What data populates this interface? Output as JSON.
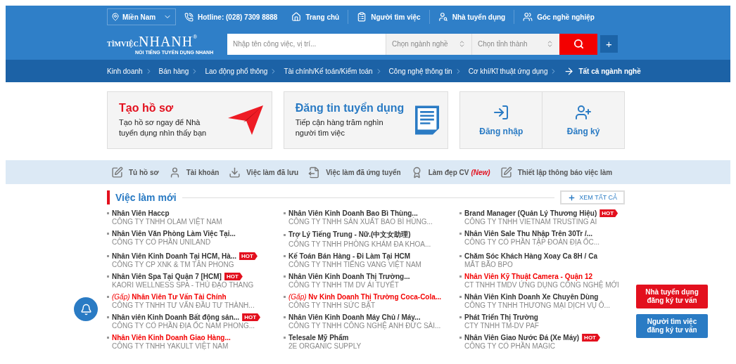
{
  "top_bar": {
    "location": "Miền Nam",
    "hotline": "Hotline: (028) 7309 8888",
    "nav": [
      {
        "label": "Trang chủ"
      },
      {
        "label": "Người tìm việc"
      },
      {
        "label": "Nhà tuyển dụng"
      },
      {
        "label": "Góc nghề nghiệp"
      }
    ]
  },
  "logo": {
    "part_1": "TÌMVIỆC",
    "part_2": "NHANH",
    "registered": "®",
    "tagline": "NỔI TIẾNG TUYỂN DỤNG NHANH"
  },
  "search": {
    "placeholder": "Nhập tên công việc, vị trí...",
    "industry": "Chọn ngành nghề",
    "province": "Chọn tỉnh thành",
    "more": "+"
  },
  "categories": [
    {
      "label": "Kinh doanh"
    },
    {
      "label": "Bán hàng"
    },
    {
      "label": "Lao động phổ thông"
    },
    {
      "label": "Tài chính/Kế toán/Kiểm toán"
    },
    {
      "label": "Công nghệ thông tin"
    },
    {
      "label": "Cơ khí/Kĩ thuật ứng dụng"
    }
  ],
  "all_categories": "Tất cả ngành nghề",
  "cards": {
    "profile": {
      "title": "Tạo hồ sơ",
      "text": "Tạo hồ sơ ngay để Nhà tuyển dụng nhìn thấy bạn"
    },
    "post": {
      "title": "Đăng tin tuyển dụng",
      "text": "Tiếp cận hàng trăm nghìn người tìm việc"
    },
    "login": "Đăng nhập",
    "register": "Đăng ký"
  },
  "quick_links": [
    {
      "label": "Tủ hồ sơ"
    },
    {
      "label": "Tài khoản"
    },
    {
      "label": "Việc làm đã lưu"
    },
    {
      "label": "Việc làm đã ứng tuyển"
    },
    {
      "label": "Làm đẹp CV",
      "badge": "(New)"
    },
    {
      "label": "Thiết lập thông báo việc làm"
    }
  ],
  "section": {
    "title": "Việc làm mới",
    "view_all": "XEM TẤT CẢ"
  },
  "jobs": [
    {
      "title": "Nhân Viên Haccp",
      "company": "CÔNG TY TNHH OLAM VIỆT NAM",
      "highlighted": false
    },
    {
      "title": "Nhân Viên Kinh Doanh Bao Bì Thùng...",
      "company": "CÔNG TY TNHH SẢN XUẤT BAO BÌ HÙNG...",
      "highlighted": false
    },
    {
      "title": "Brand Manager (Quản Lý Thương Hiệu)",
      "company": "CÔNG TY TNHH VIETNAM TRUSTING AI",
      "highlighted": false,
      "badge": "HOT"
    },
    {
      "title": "Nhân Viên Văn Phòng Làm Việc Tại...",
      "company": "CÔNG TY CỔ PHẦN UNILAND",
      "highlighted": false
    },
    {
      "title": "Trợ Lý Tiếng Trung - Nữ.(中文女助理)",
      "company": "CÔNG TY TNHH PHÒNG KHÁM ĐA KHOA...",
      "highlighted": false
    },
    {
      "title": "Nhân Viên Sale Thu Nhập Trên 30Tr /...",
      "company": "CÔNG TY CỔ PHẦN TẬP ĐOÀN ĐỊA ỐC...",
      "highlighted": false
    },
    {
      "title": "Nhân Viên Kinh Doanh Tại HCM, Hà...",
      "company": "CÔNG TY CP XNK & TM TÂN PHONG",
      "highlighted": false,
      "badge": "HOT"
    },
    {
      "title": "Kế Toán Bán Hàng - Đi Làm Tại HCM",
      "company": "CÔNG TY TNHH TIẾNG VANG VIỆT NAM",
      "highlighted": false
    },
    {
      "title": "Chăm Sóc Khách Hàng Xoay Ca 8H / Ca",
      "company": "MẮT BÃO BPO",
      "highlighted": false
    },
    {
      "title": "Nhân Viên Spa Tại Quận 7 [HCM]",
      "company": "KAORI WELLNESS SPA - THỦ ĐẠO THANG",
      "highlighted": false,
      "badge": "HOT"
    },
    {
      "title": "Nhân Viên Kinh Doanh Thị Trường...",
      "company": "CÔNG TY TNHH TM DV ÁI TUYẾT",
      "highlighted": false
    },
    {
      "title": "Nhân Viên Kỹ Thuật Camera - Quận 12",
      "company": "CT TNHH TMDV ỨNG DỤNG CÔNG NGHỆ MỚI",
      "highlighted": true
    },
    {
      "prefix": "(Gấp)",
      "title": "Nhân Viên Tư Vấn Tài Chính",
      "company": "CÔNG TY TNHH TƯ VẤN ĐẦU TƯ THÀNH...",
      "highlighted": true
    },
    {
      "prefix": "(Gấp)",
      "title": "Nv Kinh Doanh Thị Trường Coca-Cola...",
      "company": "CÔNG TY TNHH SỨC BẬT",
      "highlighted": true
    },
    {
      "title": "Nhân Viên Kinh Doanh Xe Chuyên Dùng",
      "company": "CÔNG TY TNHH THƯƠNG MẠI DỊCH VỤ Ô...",
      "highlighted": false
    },
    {
      "title": "Nhân viên Kinh Doanh Bất động sản...",
      "company": "CÔNG TY CỔ PHẦN ĐỊA ỐC NAM PHONG...",
      "highlighted": false,
      "badge": "HOT"
    },
    {
      "title": "Nhân Viên Kinh Doanh Máy Chủ / Máy...",
      "company": "CÔNG TY TNHH CÔNG NGHỆ ANH ĐỨC SÀI...",
      "highlighted": false
    },
    {
      "title": "Phát Triển Thị Trường",
      "company": "CTY TNHH TM-DV PAF",
      "highlighted": false
    },
    {
      "title": "Nhân Viên Kinh Doanh Giao Hàng...",
      "company": "CÔNG TY TNHH YAKULT VIỆT NAM",
      "highlighted": true
    },
    {
      "title": "Telesale Mỹ Phẩm",
      "company": "2E ORGANIC SUPPLY",
      "highlighted": false
    },
    {
      "title": "Nhân Viên Giao Nước Đá (Xe Máy)",
      "company": "CÔNG TY CỔ PHẦN MAGIC",
      "highlighted": false,
      "badge": "HOT"
    }
  ],
  "floating": {
    "employer": "Nhà tuyển dụng đăng ký tư vấn",
    "seeker": "Người tìm việc đăng ký tư vấn"
  }
}
